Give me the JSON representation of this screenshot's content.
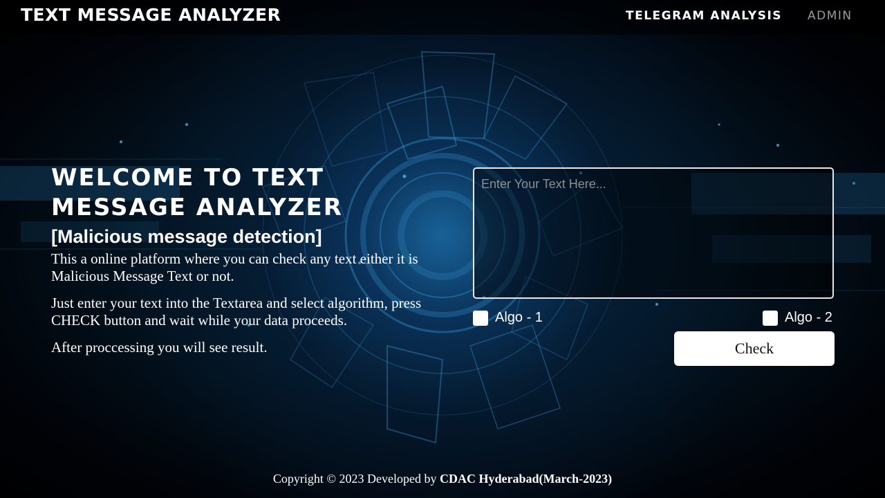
{
  "navbar": {
    "brand": "TEXT MESSAGE ANALYZER",
    "links": [
      {
        "label": "TELEGRAM ANALYSIS"
      },
      {
        "label": "ADMIN"
      }
    ]
  },
  "intro": {
    "welcome_line1": "WELCOME TO TEXT",
    "welcome_line2": "MESSAGE ANALYZER",
    "subtitle": "[Malicious message detection]",
    "paragraphs": [
      "This a online platform where you can check any text either it is Malicious Message Text or not.",
      "Just enter your text into the Textarea and select algorithm, press CHECK button and wait while your data proceeds.",
      "After proccessing you will see result."
    ]
  },
  "form": {
    "textarea_placeholder": "Enter Your Text Here...",
    "algo1_label": "Algo - 1",
    "algo2_label": "Algo - 2",
    "check_label": "Check"
  },
  "footer": {
    "text": "Copyright © 2023 Developed by ",
    "org": "CDAC Hyderabad(March-2023)"
  },
  "colors": {
    "background": "#000000",
    "accent_glow": "#2896e6",
    "admin_link": "#9a9a9a"
  }
}
